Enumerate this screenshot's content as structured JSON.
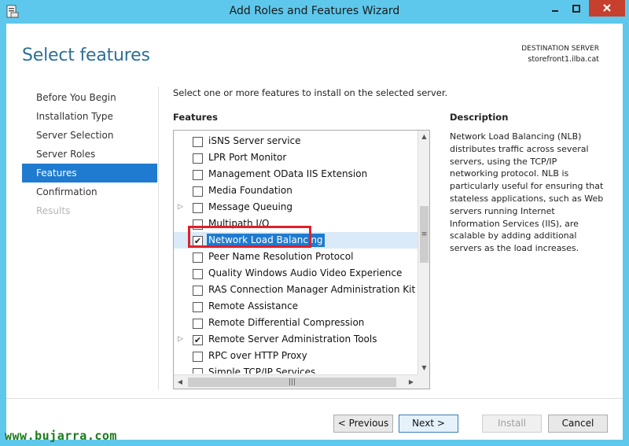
{
  "window": {
    "title": "Add Roles and Features Wizard"
  },
  "header": {
    "page_title": "Select features",
    "destination_label": "DESTINATION SERVER",
    "destination_value": "storefront1.ilba.cat"
  },
  "nav": {
    "items": [
      {
        "label": "Before You Begin",
        "state": "normal"
      },
      {
        "label": "Installation Type",
        "state": "normal"
      },
      {
        "label": "Server Selection",
        "state": "normal"
      },
      {
        "label": "Server Roles",
        "state": "normal"
      },
      {
        "label": "Features",
        "state": "active"
      },
      {
        "label": "Confirmation",
        "state": "normal"
      },
      {
        "label": "Results",
        "state": "disabled"
      }
    ]
  },
  "main": {
    "instruction": "Select one or more features to install on the selected server.",
    "features_heading": "Features",
    "features": [
      {
        "label": "iSNS Server service",
        "checked": false,
        "expandable": false
      },
      {
        "label": "LPR Port Monitor",
        "checked": false,
        "expandable": false
      },
      {
        "label": "Management OData IIS Extension",
        "checked": false,
        "expandable": false
      },
      {
        "label": "Media Foundation",
        "checked": false,
        "expandable": false
      },
      {
        "label": "Message Queuing",
        "checked": false,
        "expandable": true
      },
      {
        "label": "Multipath I/O",
        "checked": false,
        "expandable": false
      },
      {
        "label": "Network Load Balancing",
        "checked": true,
        "expandable": false,
        "selected": true
      },
      {
        "label": "Peer Name Resolution Protocol",
        "checked": false,
        "expandable": false
      },
      {
        "label": "Quality Windows Audio Video Experience",
        "checked": false,
        "expandable": false
      },
      {
        "label": "RAS Connection Manager Administration Kit (CMA",
        "checked": false,
        "expandable": false
      },
      {
        "label": "Remote Assistance",
        "checked": false,
        "expandable": false
      },
      {
        "label": "Remote Differential Compression",
        "checked": false,
        "expandable": false
      },
      {
        "label": "Remote Server Administration Tools",
        "checked": true,
        "expandable": true
      },
      {
        "label": "RPC over HTTP Proxy",
        "checked": false,
        "expandable": false
      },
      {
        "label": "Simple TCP/IP Services",
        "checked": false,
        "expandable": false
      }
    ]
  },
  "description": {
    "heading": "Description",
    "body": "Network Load Balancing (NLB) distributes traffic across several servers, using the TCP/IP networking protocol. NLB is particularly useful for ensuring that stateless applications, such as Web servers running Internet Information Services (IIS), are scalable by adding additional servers as the load increases."
  },
  "footer": {
    "previous": "< Previous",
    "next": "Next >",
    "install": "Install",
    "cancel": "Cancel"
  },
  "watermark": "www.bujarra.com",
  "colors": {
    "accent": "#1f7bcf",
    "title_blue": "#2a6f9a",
    "highlight_red": "#e0202a",
    "titlebar": "#5ec8ec",
    "close_button": "#c7402e"
  }
}
